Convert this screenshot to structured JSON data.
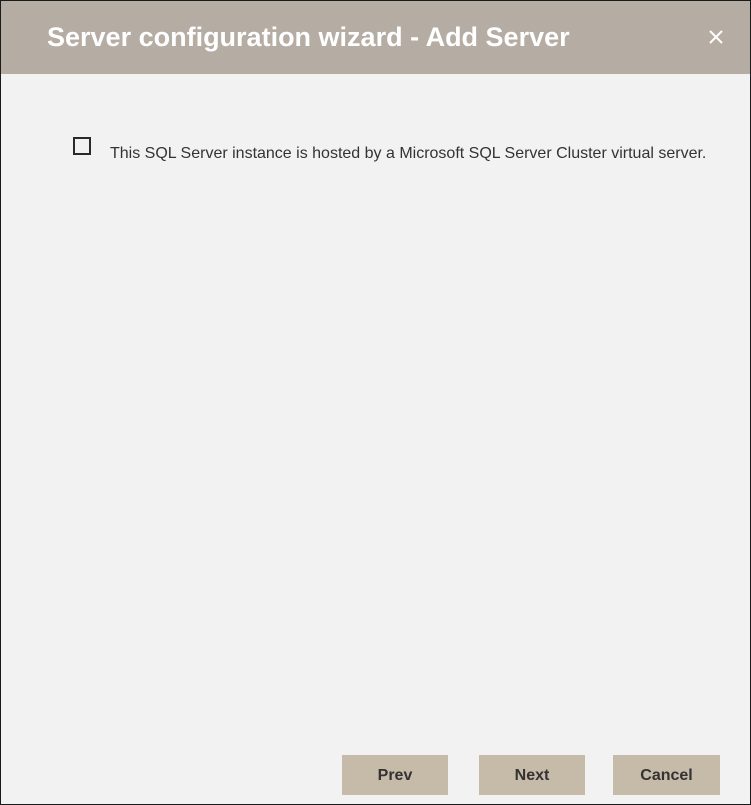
{
  "dialog": {
    "title": "Server configuration wizard - Add Server",
    "close_icon": "close-icon",
    "checkbox": {
      "label": "This SQL Server instance is hosted by a Microsoft SQL Server Cluster virtual server.",
      "checked": false
    },
    "buttons": {
      "prev": "Prev",
      "next": "Next",
      "cancel": "Cancel"
    }
  },
  "colors": {
    "titlebar": "#b5aca3",
    "body": "#f2f2f2",
    "button": "#c6baa9"
  }
}
